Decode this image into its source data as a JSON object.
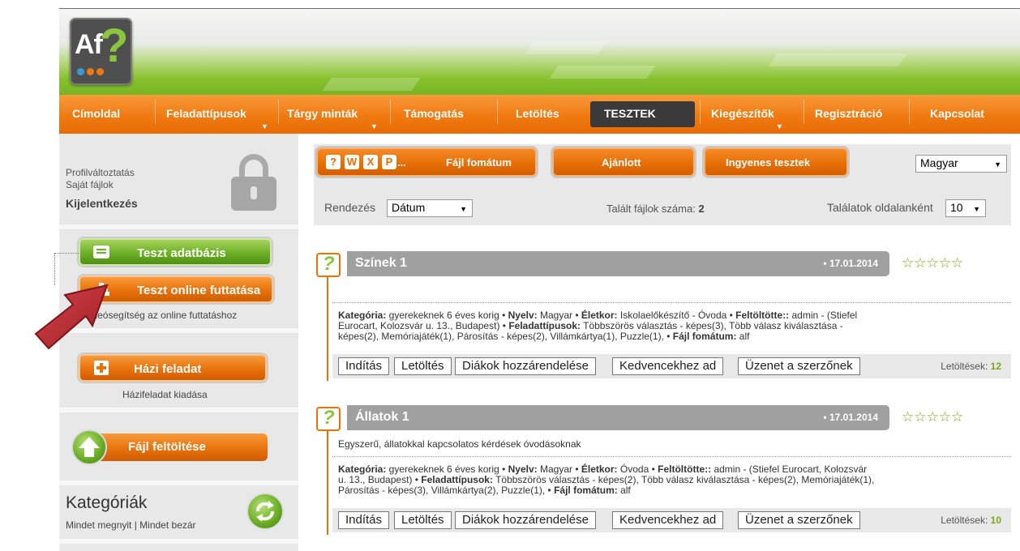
{
  "nav": {
    "items": [
      "Címoldal",
      "Feladattípusok",
      "Tárgy minták",
      "Támogatás",
      "Letöltés",
      "TESZTEK",
      "Kiegészítők",
      "Regisztráció",
      "Kapcsolat"
    ]
  },
  "sidebar": {
    "profile_change": "Profilváltoztatás",
    "my_files": "Saját fájlok",
    "logout": "Kijelentkezés",
    "test_db": "Teszt adatbázis",
    "test_online": "Teszt online futtatása",
    "video_help": "Videósegítség az online futtatáshoz",
    "homework": "Házi feladat",
    "homework_sub": "Házifeladat kiadása",
    "upload": "Fájl feltöltése",
    "categories": "Kategóriák",
    "open_all": "Mindet megnyit",
    "link_sep": " | ",
    "close_all": "Mindet bezár"
  },
  "filters": {
    "format_icons_more": "...",
    "format_btn": "Fájl fomátum",
    "recommended_btn": "Ajánlott",
    "free_btn": "Ingyenes tesztek",
    "language": "Magyar",
    "sort_label": "Rendezés",
    "sort_value": "Dátum",
    "found_label": "Talált fájlok száma:",
    "found_count": "2",
    "per_page_label": "Találatok oldalanként",
    "per_page_value": "10"
  },
  "results": [
    {
      "title": "Színek 1",
      "date": "• 17.01.2014",
      "rating_stars": "☆☆☆☆☆",
      "description": "",
      "meta_lines": [
        "Kategória: gyerekeknek 6 éves korig • Nyelv: Magyar • Életkor: Iskolaelőkészítő - Óvoda • Feltöltötte:: admin - (Stiefel",
        "Eurocart, Kolozsvár u. 13., Budapest) • Feladattípusok: Többszörös választás - képes(3), Több válasz kiválasztása -",
        "képes(2), Memóriajáték(1), Párosítás - képes(2), Villámkártya(1), Puzzle(1), • Fájl fomátum: alf"
      ],
      "downloads_label": "Letöltések:",
      "downloads": "12"
    },
    {
      "title": "Állatok 1",
      "date": "• 17.01.2014",
      "rating_stars": "☆☆☆☆☆",
      "description": "Egyszerű, állatokkal kapcsolatos kérdések óvodásoknak",
      "meta_lines": [
        "Kategória: gyerekeknek 6 éves korig • Nyelv: Magyar • Életkor: Óvoda • Feltöltötte:: admin - (Stiefel Eurocart, Kolozsvár",
        "u. 13., Budapest) • Feladattípusok: Többszörös választás - képes(2), Több válasz kiválasztása - képes(2), Memóriajáték(1),",
        "Párosítás - képes(3), Villámkártya(2), Puzzle(1), • Fájl fomátum: alf"
      ],
      "downloads_label": "Letöltések:",
      "downloads": "10"
    }
  ],
  "actions": {
    "start": "Indítás",
    "download": "Letöltés",
    "assign": "Diákok hozzárendelése",
    "favorite": "Kedvencekhez ad",
    "message": "Üzenet a szerzőnek"
  },
  "colors": {
    "accent_orange": "#e8720c",
    "accent_green": "#6db026",
    "rating_green": "#7ea51f"
  }
}
